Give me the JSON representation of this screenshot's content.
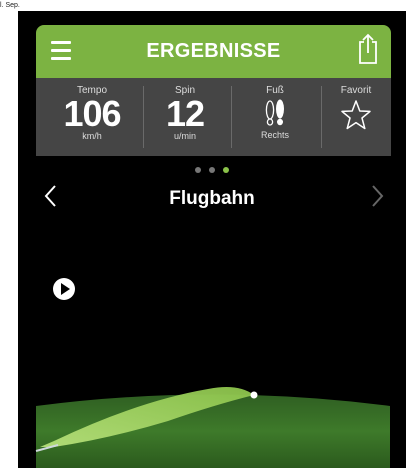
{
  "edge_label": "l. Sep.",
  "header": {
    "title": "ERGEBNISSE",
    "menu_icon": "hamburger-menu-icon",
    "share_icon": "share-icon"
  },
  "stats": {
    "tempo": {
      "label": "Tempo",
      "value": "106",
      "unit": "km/h"
    },
    "spin": {
      "label": "Spin",
      "value": "12",
      "unit": "u/min"
    },
    "foot": {
      "label": "Fuß",
      "value": "Rechts",
      "icon": "footprints-icon"
    },
    "favorite": {
      "label": "Favorit",
      "icon": "star-outline-icon"
    }
  },
  "pager": {
    "pages": 3,
    "active_index": 2
  },
  "section": {
    "title": "Flugbahn",
    "prev_icon": "chevron-left-icon",
    "next_icon": "chevron-right-icon"
  },
  "replay": {
    "icon": "play-icon"
  },
  "colors": {
    "accent": "#7cb342",
    "stats_bg": "#454545",
    "background": "#000000",
    "active_dot": "#8bc34a",
    "trajectory": "#9ccc3c"
  }
}
